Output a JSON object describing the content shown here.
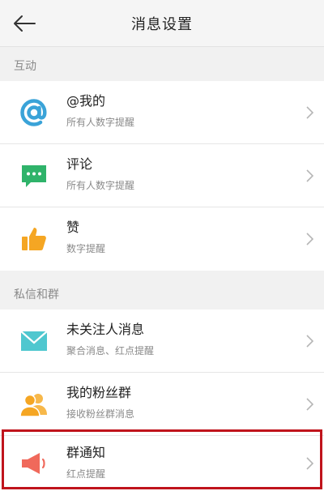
{
  "header": {
    "title": "消息设置",
    "back_icon": "arrow-left-icon"
  },
  "sections": [
    {
      "label": "互动",
      "items": [
        {
          "title": "@我的",
          "subtitle": "所有人数字提醒",
          "icon": "at-sign-icon",
          "icon_color": "#3aa3d8"
        },
        {
          "title": "评论",
          "subtitle": "所有人数字提醒",
          "icon": "comment-bubble-icon",
          "icon_color": "#2fb36a"
        },
        {
          "title": "赞",
          "subtitle": "数字提醒",
          "icon": "thumbs-up-icon",
          "icon_color": "#f5a623"
        }
      ]
    },
    {
      "label": "私信和群",
      "items": [
        {
          "title": "未关注人消息",
          "subtitle": "聚合消息、红点提醒",
          "icon": "envelope-icon",
          "icon_color": "#4fc7cf"
        },
        {
          "title": "我的粉丝群",
          "subtitle": "接收粉丝群消息",
          "icon": "people-group-icon",
          "icon_color": "#f5a623"
        },
        {
          "title": "群通知",
          "subtitle": "红点提醒",
          "icon": "megaphone-icon",
          "icon_color": "#f0695b"
        }
      ]
    }
  ],
  "highlight_color": "#c0141c"
}
